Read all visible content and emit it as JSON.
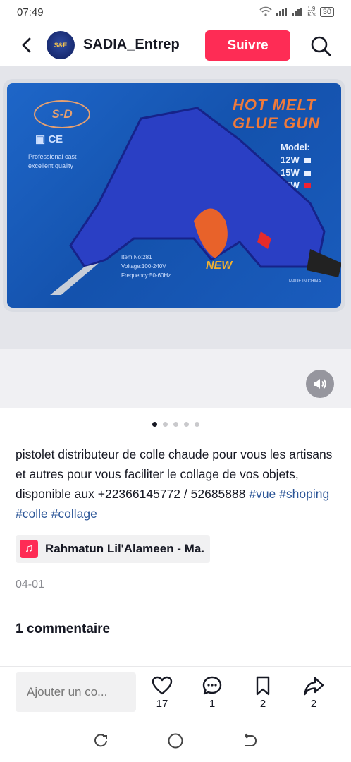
{
  "status": {
    "time": "07:49",
    "speed": "1.9\nK/s",
    "battery": "30"
  },
  "header": {
    "username": "SADIA_Entrep",
    "follow_label": "Suivre",
    "avatar_text": "S&E"
  },
  "product": {
    "logo": "S-D",
    "ce": "▣ CE",
    "pro_text": "Professional cast excellent quality",
    "title": "HOT MELT GLUE GUN",
    "model_label": "Model:",
    "models": [
      "12W",
      "15W",
      "20W"
    ],
    "item_no": "Item No:281",
    "voltage": "Voltage:100-240V",
    "frequency": "Frequency:50-60Hz",
    "new_badge": "NEW",
    "made_in": "MADE IN CHINA"
  },
  "carousel": {
    "count": 5,
    "active": 0
  },
  "post": {
    "text": "pistolet distributeur de colle chaude pour vous les artisans et autres pour vous faciliter le collage de vos objets, disponible aux +22366145772 / 52685888 ",
    "hashtags": [
      "#vue",
      "#shoping",
      "#colle",
      "#collage"
    ],
    "music": "Rahmatun Lil'Alameen - Ma.",
    "date": "04-01",
    "comments_label": "1 commentaire"
  },
  "actions": {
    "comment_placeholder": "Ajouter un co...",
    "likes": "17",
    "comments": "1",
    "saves": "2",
    "shares": "2"
  },
  "colors": {
    "accent": "#fe2c55",
    "hashtag": "#2b5597"
  }
}
